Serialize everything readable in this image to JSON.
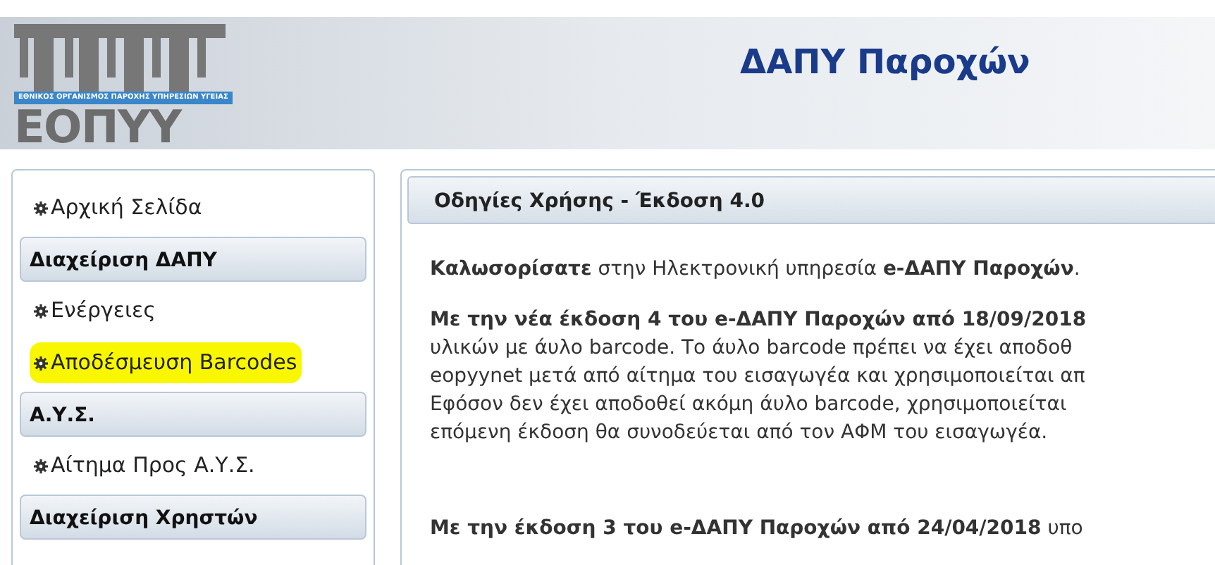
{
  "header": {
    "logo": {
      "band_text": "ΕΘΝΙΚΟΣ ΟΡΓΑΝΙΣΜΟΣ ΠΑΡΟΧΗΣ ΥΠΗΡΕΣΙΩΝ ΥΓΕΙΑΣ",
      "wordmark": "ΕΟΠΥΥ"
    },
    "title": "ΔΑΠΥ Παροχών"
  },
  "sidebar": {
    "items": [
      {
        "kind": "link",
        "label": "Αρχική Σελίδα",
        "highlighted": false
      },
      {
        "kind": "section",
        "label": "Διαχείριση ΔΑΠΥ"
      },
      {
        "kind": "link",
        "label": "Ενέργειες",
        "highlighted": false
      },
      {
        "kind": "link",
        "label": "Αποδέσμευση Barcodes",
        "highlighted": true
      },
      {
        "kind": "section",
        "label": "Α.Υ.Σ."
      },
      {
        "kind": "link",
        "label": "Αίτημα Προς Α.Υ.Σ.",
        "highlighted": false
      },
      {
        "kind": "section",
        "label": "Διαχείριση Χρηστών"
      }
    ]
  },
  "main": {
    "title": "Οδηγίες Χρήσης - Έκδοση 4.0",
    "paragraphs": [
      {
        "lines": [
          "**Καλωσορίσατε** στην Ηλεκτρονική υπηρεσία **e-ΔΑΠΥ Παροχών**."
        ]
      },
      {
        "lines": [
          "**Με την νέα έκδοση 4 του e-ΔΑΠΥ Παροχών από 18/09/2018**",
          "υλικών με άυλο barcode. Το άυλο barcode πρέπει να έχει αποδοθ",
          "eopyynet μετά από αίτημα του εισαγωγέα και χρησιμοποιείται απ",
          "Εφόσον δεν έχει αποδοθεί ακόμη άυλο barcode, χρησιμοποιείται",
          "επόμενη έκδοση θα συνοδεύεται από τον ΑΦΜ του εισαγωγέα."
        ]
      },
      {
        "lines": [
          "**Με την έκδοση 3 του e-ΔΑΠΥ Παροχών από 24/04/2018** υπο"
        ]
      }
    ]
  }
}
